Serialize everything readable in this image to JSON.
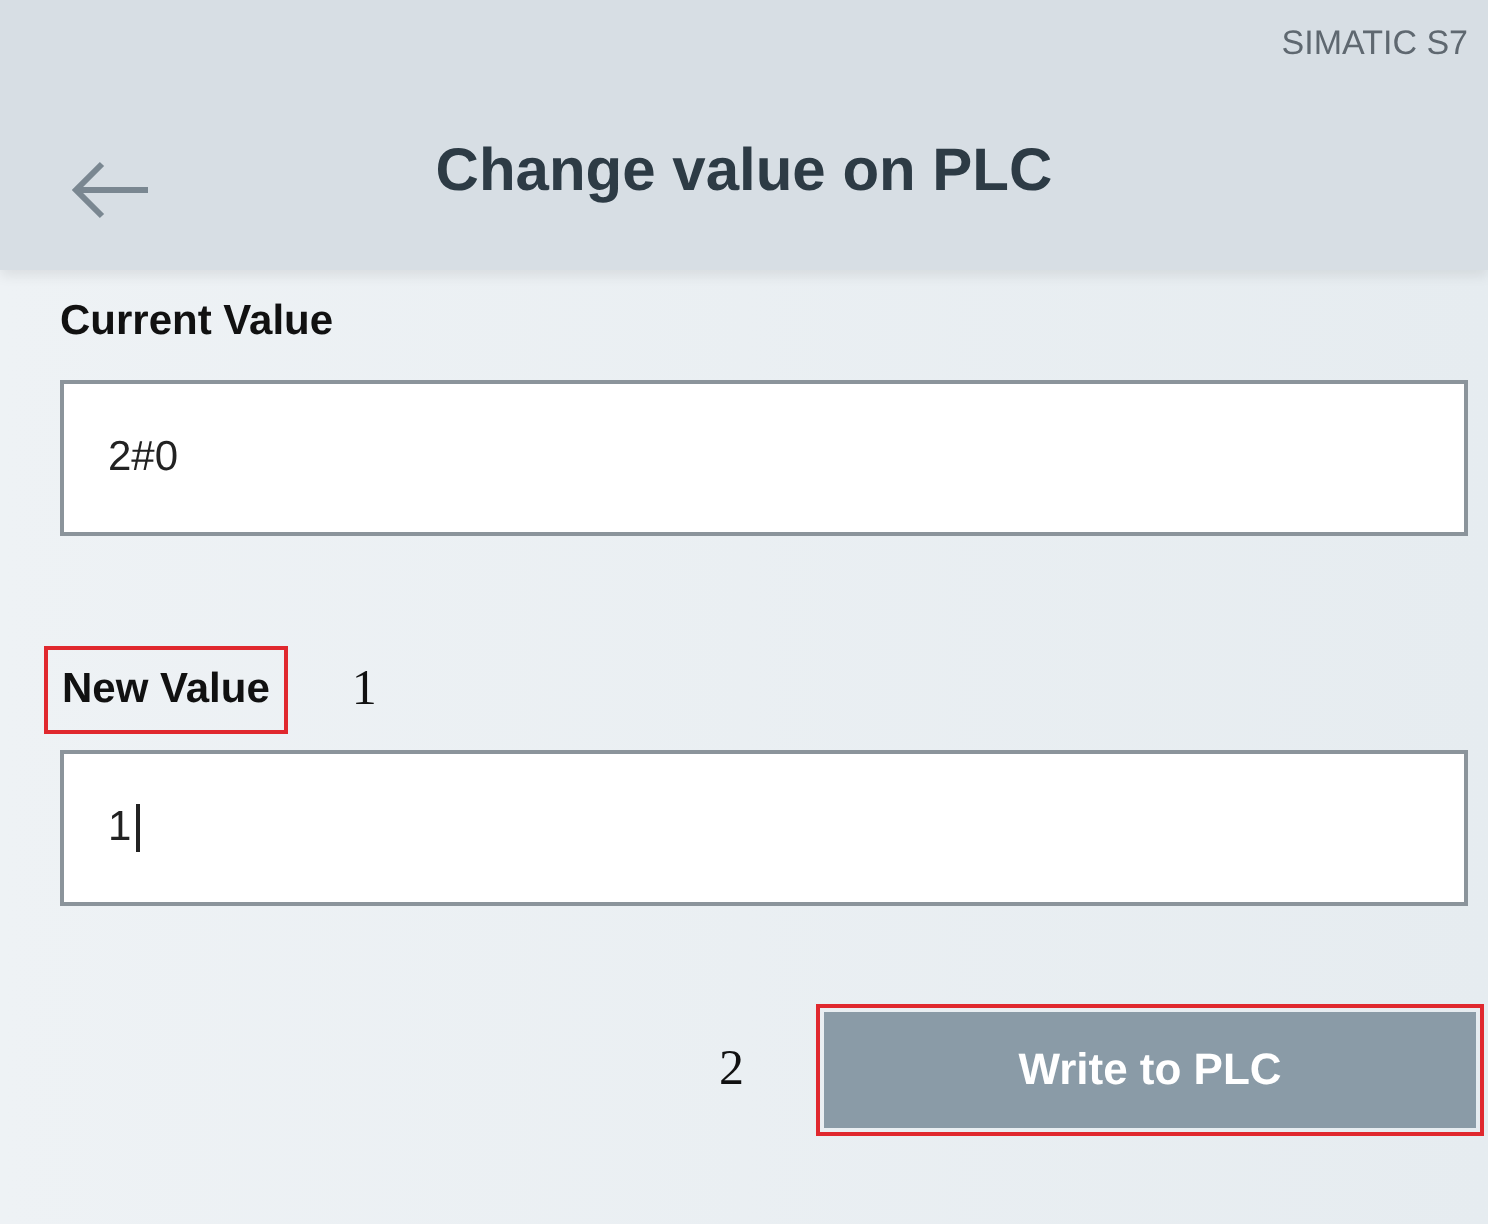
{
  "header": {
    "device": "SIMATIC S7",
    "title": "Change value on PLC"
  },
  "current": {
    "label": "Current Value",
    "value": "2#0"
  },
  "new_value": {
    "label": "New Value",
    "value": "1",
    "focused": true,
    "highlighted": true,
    "marker": "1"
  },
  "button": {
    "label": "Write to PLC",
    "highlighted": true,
    "marker": "2"
  }
}
